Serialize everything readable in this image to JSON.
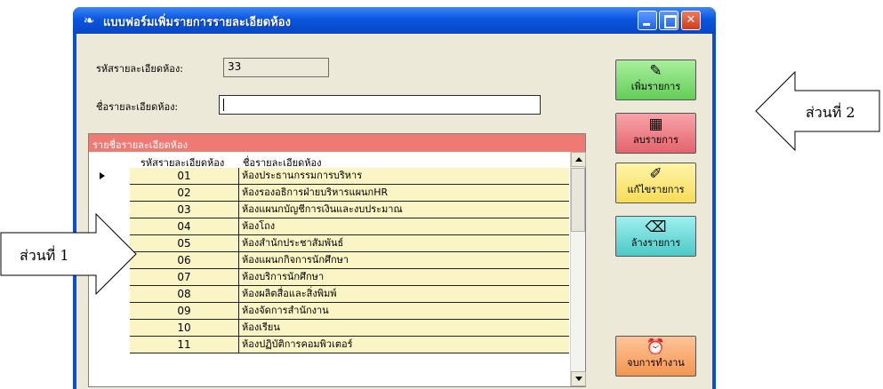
{
  "window": {
    "title": "แบบฟอร์มเพิ่มรายการรายละเอียดห้อง",
    "controls": [
      "minimize-icon",
      "maximize-icon",
      "close-icon"
    ]
  },
  "form": {
    "code_label": "รหัสรายละเอียดห้อง:",
    "code_value": "33",
    "name_label": "ชื่อรายละเอียดห้อง:",
    "name_value": ""
  },
  "grid": {
    "caption": "รายชื่อรายละเอียดห้อง",
    "headers": [
      "รหัสรายละเอียดห้อง",
      "ชื่อรายละเอียดห้อง"
    ],
    "rows": [
      {
        "code": "01",
        "name": "ห้องประธานกรรมการบริหาร"
      },
      {
        "code": "02",
        "name": "ห้องรองอธิการฝ่ายบริหารแผนกHR"
      },
      {
        "code": "03",
        "name": "ห้องแผนกบัญชีการเงินและงบประมาณ"
      },
      {
        "code": "04",
        "name": "ห้องโถง"
      },
      {
        "code": "05",
        "name": "ห้องสำนักประชาสัมพันธ์"
      },
      {
        "code": "06",
        "name": "ห้องแผนกกิจการนักศึกษา"
      },
      {
        "code": "07",
        "name": "ห้องบริการนักศึกษา"
      },
      {
        "code": "08",
        "name": "ห้องผลิตสื่อและสิ่งพิมพ์"
      },
      {
        "code": "09",
        "name": "ห้องจัดการสำนักงาน"
      },
      {
        "code": "10",
        "name": "ห้องเรียน"
      },
      {
        "code": "11",
        "name": "ห้องปฏิบัติการคอมพิวเตอร์"
      }
    ]
  },
  "buttons": {
    "add": "เพิ่มรายการ",
    "delete": "ลบรายการ",
    "edit": "แก้ไขรายการ",
    "clear": "ล้างรายการ",
    "exit": "จบการทำงาน"
  },
  "callouts": {
    "part1": "ส่วนที่ 1",
    "part2": "ส่วนที่ 2"
  }
}
